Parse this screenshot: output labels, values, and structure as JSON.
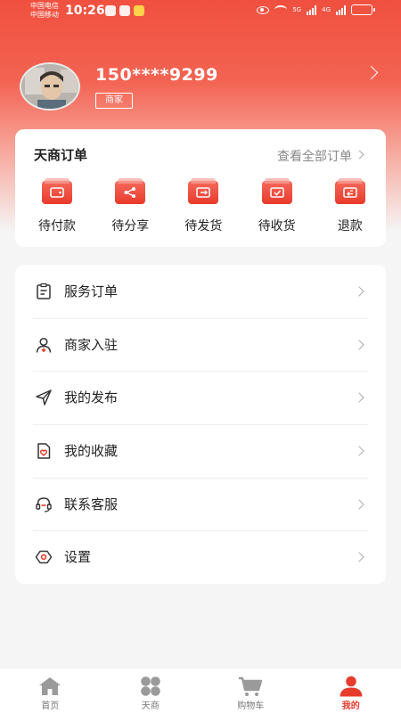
{
  "status_bar": {
    "carrier1": "中国电信",
    "carrier2": "中国移动",
    "time": "10:26",
    "network1": "5G",
    "network2": "4G"
  },
  "profile": {
    "phone": "150****9299",
    "role": "商家"
  },
  "orders": {
    "title": "天商订单",
    "view_all": "查看全部订单",
    "items": [
      {
        "label": "待付款",
        "icon": "wallet-icon"
      },
      {
        "label": "待分享",
        "icon": "share-icon"
      },
      {
        "label": "待发货",
        "icon": "ship-icon"
      },
      {
        "label": "待收货",
        "icon": "receive-icon"
      },
      {
        "label": "退款",
        "icon": "refund-icon"
      }
    ]
  },
  "menu": {
    "items": [
      {
        "label": "服务订单",
        "icon": "clipboard-icon"
      },
      {
        "label": "商家入驻",
        "icon": "user-add-icon"
      },
      {
        "label": "我的发布",
        "icon": "send-icon"
      },
      {
        "label": "我的收藏",
        "icon": "heart-doc-icon"
      },
      {
        "label": "联系客服",
        "icon": "headset-icon"
      },
      {
        "label": "设置",
        "icon": "settings-icon"
      }
    ]
  },
  "tabbar": {
    "items": [
      {
        "label": "首页",
        "icon": "home-icon",
        "active": false
      },
      {
        "label": "天商",
        "icon": "grid-icon",
        "active": false
      },
      {
        "label": "购物车",
        "icon": "cart-icon",
        "active": false
      },
      {
        "label": "我的",
        "icon": "user-icon",
        "active": true
      }
    ]
  },
  "colors": {
    "accent": "#e73b2c",
    "hero_top": "#f0503f"
  }
}
